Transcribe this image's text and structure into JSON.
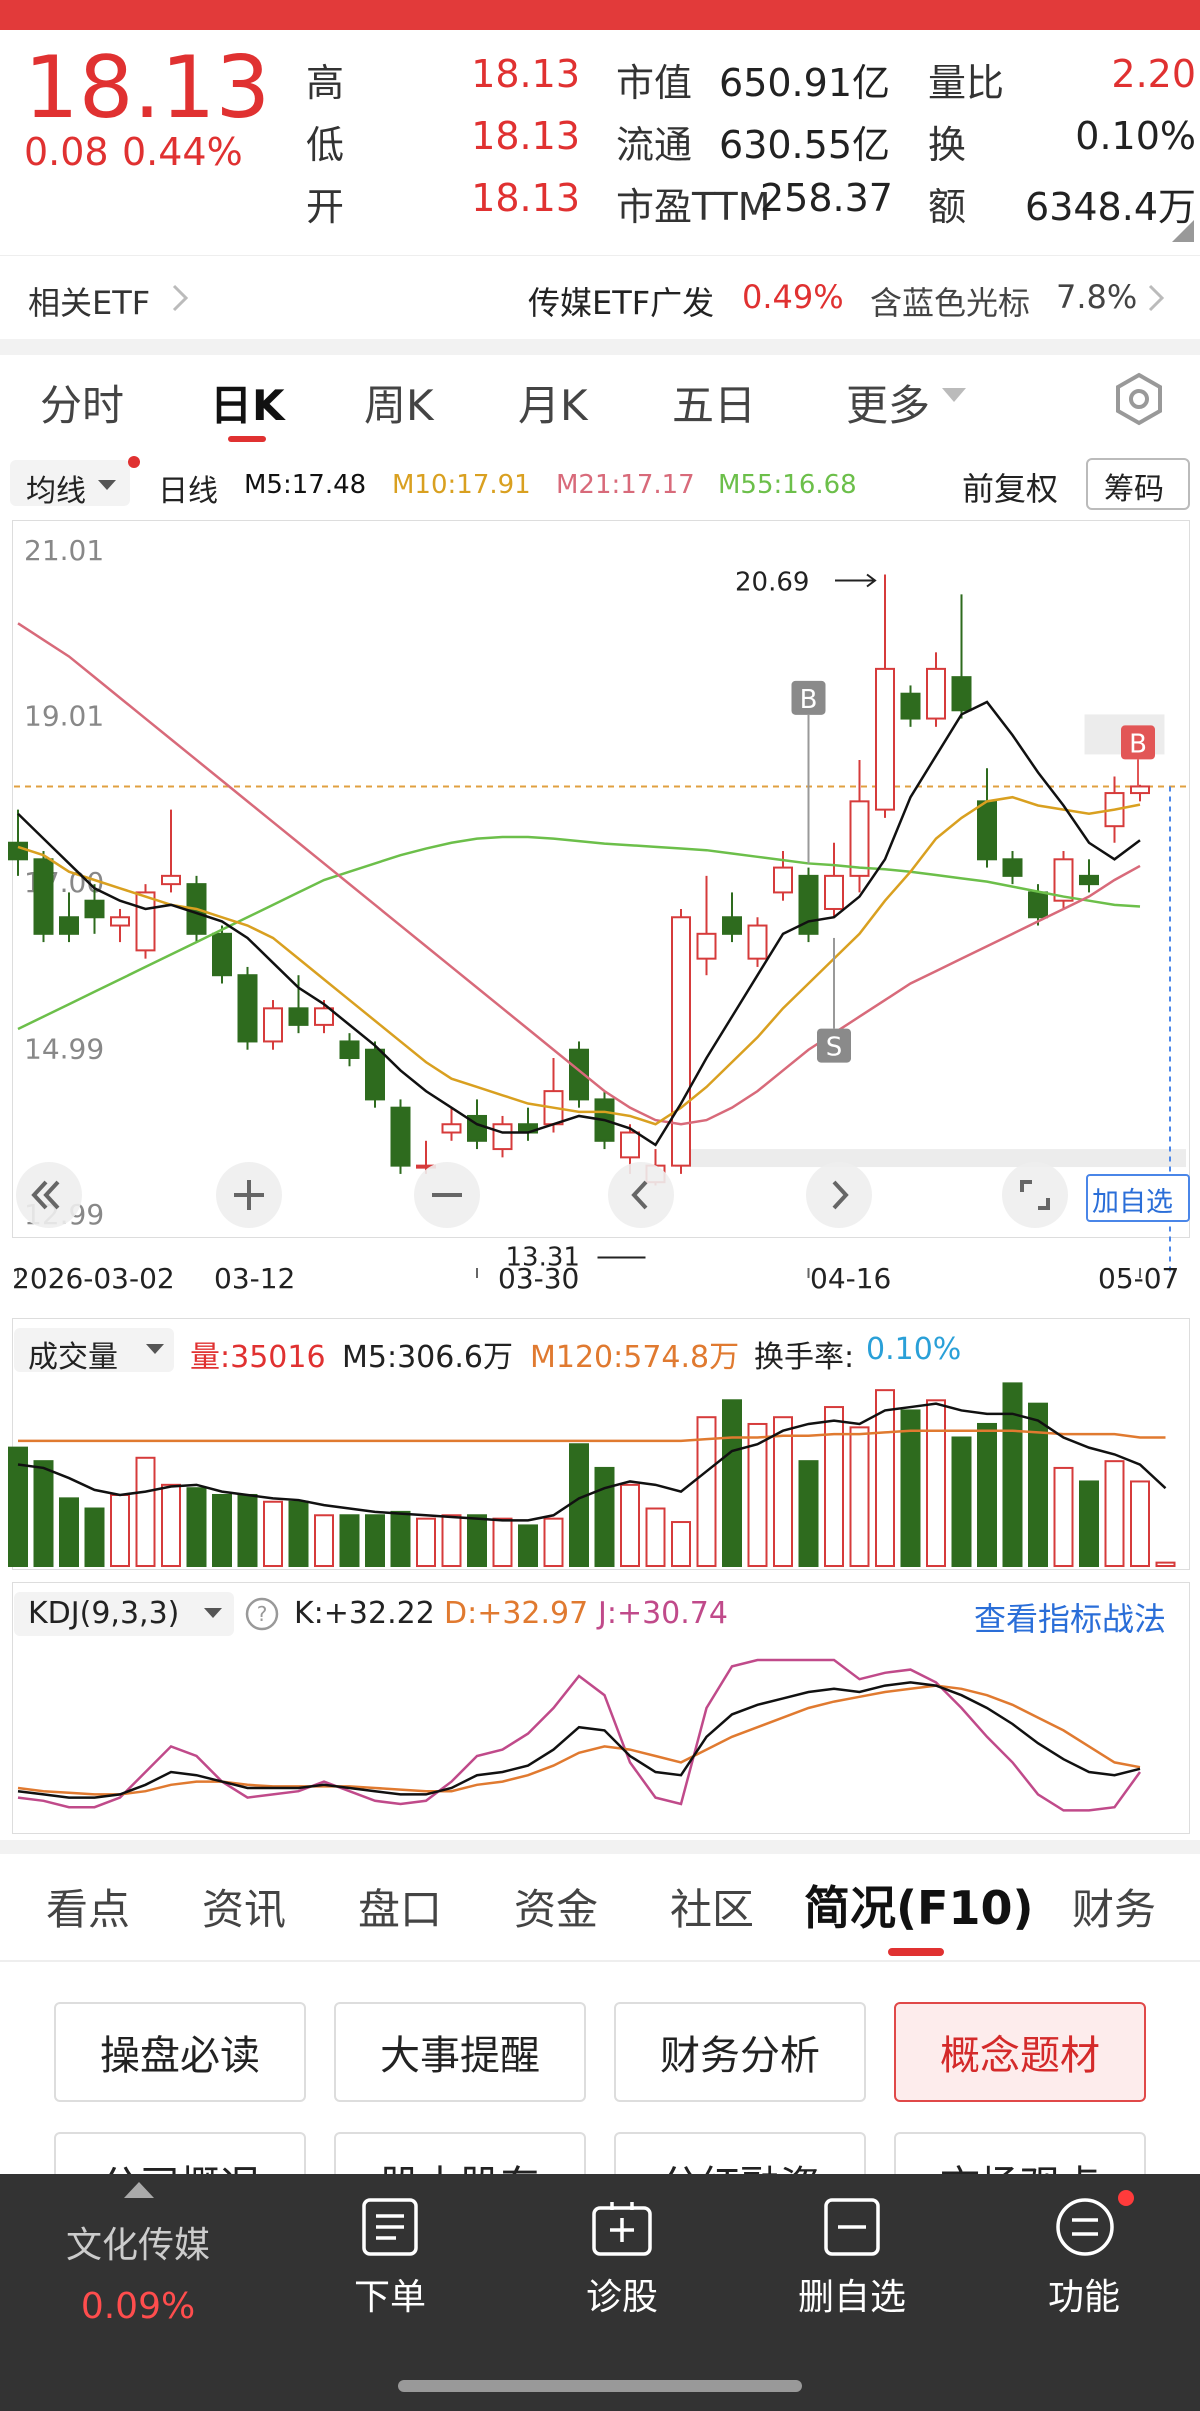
{
  "quote": {
    "price": "18.13",
    "change": "0.08",
    "change_pct": "0.44%",
    "high_label": "高",
    "high": "18.13",
    "low_label": "低",
    "low": "18.13",
    "open_label": "开",
    "open": "18.13",
    "mktcap_label": "市值",
    "mktcap": "650.91亿",
    "float_label": "流通",
    "float": "630.55亿",
    "pe_label": "市盈TTM",
    "pe": "258.37",
    "volratio_label": "量比",
    "volratio": "2.20",
    "turnover_label": "换",
    "turnover": "0.10%",
    "amount_label": "额",
    "amount": "6348.4万"
  },
  "etf": {
    "label": "相关ETF",
    "etf1_name": "传媒ETF广发",
    "etf1_pct": "0.49%",
    "etf2_name": "含蓝色光标",
    "etf2_pct": "7.8%"
  },
  "tabs": [
    "分时",
    "日K",
    "周K",
    "月K",
    "五日",
    "更多"
  ],
  "ma": {
    "selector": "均线",
    "period": "日线",
    "m5": "M5:17.48",
    "m10": "M10:17.91",
    "m21": "M21:17.17",
    "m55": "M55:16.68",
    "adjust": "前复权",
    "chip": "筹码",
    "colors": {
      "m5": "#111111",
      "m10": "#d9a020",
      "m21": "#d86a7a",
      "m55": "#6cbf4a"
    }
  },
  "chart_data": {
    "type": "candlestick",
    "y_ticks": [
      "21.01",
      "19.01",
      "17.00",
      "14.99",
      "12.99"
    ],
    "ylim": [
      12.99,
      21.01
    ],
    "x_ticks": [
      "2026-03-02",
      "03-12",
      "03-30",
      "04-16",
      "05-07"
    ],
    "high_mark": "20.69",
    "low_mark": "13.31",
    "markers": [
      "B",
      "S",
      "B"
    ],
    "add_watch": "加自选",
    "candles": [
      [
        17.45,
        17.25,
        17.85,
        17.05
      ],
      [
        17.25,
        16.35,
        17.35,
        16.25
      ],
      [
        16.55,
        16.35,
        16.85,
        16.25
      ],
      [
        16.75,
        16.55,
        16.95,
        16.35
      ],
      [
        16.45,
        16.55,
        16.65,
        16.25
      ],
      [
        16.15,
        16.85,
        16.95,
        16.05
      ],
      [
        16.95,
        17.05,
        17.85,
        16.85
      ],
      [
        16.95,
        16.35,
        17.05,
        16.25
      ],
      [
        16.35,
        15.85,
        16.45,
        15.75
      ],
      [
        15.85,
        15.05,
        15.95,
        14.95
      ],
      [
        15.05,
        15.45,
        15.55,
        14.95
      ],
      [
        15.45,
        15.25,
        15.85,
        15.15
      ],
      [
        15.25,
        15.45,
        15.55,
        15.15
      ],
      [
        15.05,
        14.85,
        15.15,
        14.75
      ],
      [
        14.95,
        14.35,
        15.05,
        14.25
      ],
      [
        14.25,
        13.55,
        14.35,
        13.45
      ],
      [
        13.55,
        13.55,
        13.85,
        13.45
      ],
      [
        13.95,
        14.05,
        14.25,
        13.85
      ],
      [
        14.15,
        13.85,
        14.35,
        13.75
      ],
      [
        13.75,
        14.05,
        14.15,
        13.65
      ],
      [
        14.05,
        13.95,
        14.25,
        13.85
      ],
      [
        14.05,
        14.45,
        14.85,
        13.95
      ],
      [
        14.95,
        14.35,
        15.05,
        14.25
      ],
      [
        14.35,
        13.85,
        14.45,
        13.75
      ],
      [
        13.65,
        13.95,
        14.05,
        13.45
      ],
      [
        13.35,
        13.55,
        13.75,
        13.31
      ],
      [
        13.55,
        16.55,
        16.65,
        13.45
      ],
      [
        16.05,
        16.35,
        17.05,
        15.85
      ],
      [
        16.55,
        16.35,
        16.85,
        16.25
      ],
      [
        16.05,
        16.45,
        16.55,
        15.95
      ],
      [
        16.85,
        17.15,
        17.35,
        16.75
      ],
      [
        17.05,
        16.35,
        17.15,
        16.25
      ],
      [
        16.65,
        17.05,
        17.45,
        16.55
      ],
      [
        17.05,
        17.95,
        18.45,
        16.85
      ],
      [
        17.85,
        19.55,
        20.69,
        17.75
      ],
      [
        19.25,
        18.95,
        19.35,
        18.85
      ],
      [
        18.95,
        19.55,
        19.75,
        18.85
      ],
      [
        19.45,
        19.05,
        20.45,
        18.95
      ],
      [
        17.95,
        17.25,
        18.35,
        17.15
      ],
      [
        17.25,
        17.05,
        17.35,
        16.95
      ],
      [
        16.85,
        16.55,
        16.95,
        16.45
      ],
      [
        16.75,
        17.25,
        17.35,
        16.65
      ],
      [
        17.05,
        16.95,
        17.25,
        16.85
      ],
      [
        17.65,
        18.05,
        18.25,
        17.45
      ],
      [
        18.05,
        18.13,
        18.15,
        17.95
      ]
    ],
    "m5": [
      17.8,
      17.5,
      17.2,
      16.9,
      16.75,
      16.65,
      16.7,
      16.6,
      16.5,
      16.3,
      16.0,
      15.7,
      15.5,
      15.25,
      15.0,
      14.7,
      14.45,
      14.25,
      14.05,
      13.95,
      13.95,
      14.05,
      14.15,
      14.1,
      14.0,
      13.8,
      14.3,
      14.85,
      15.35,
      15.85,
      16.35,
      16.5,
      16.55,
      16.8,
      17.25,
      18.0,
      18.5,
      19.0,
      19.15,
      18.75,
      18.3,
      17.9,
      17.45,
      17.25,
      17.48
    ],
    "m10": [
      17.4,
      17.3,
      17.1,
      17.0,
      16.9,
      16.8,
      16.7,
      16.65,
      16.55,
      16.45,
      16.3,
      16.05,
      15.8,
      15.55,
      15.3,
      15.05,
      14.8,
      14.6,
      14.5,
      14.4,
      14.3,
      14.25,
      14.2,
      14.2,
      14.15,
      14.05,
      14.25,
      14.5,
      14.8,
      15.1,
      15.45,
      15.75,
      16.05,
      16.35,
      16.75,
      17.1,
      17.5,
      17.75,
      17.95,
      18.0,
      17.9,
      17.85,
      17.8,
      17.85,
      17.91
    ],
    "m21": [
      20.1,
      19.9,
      19.7,
      19.45,
      19.2,
      18.95,
      18.7,
      18.45,
      18.2,
      17.95,
      17.7,
      17.45,
      17.2,
      16.95,
      16.7,
      16.45,
      16.2,
      15.95,
      15.7,
      15.45,
      15.2,
      14.95,
      14.7,
      14.45,
      14.25,
      14.1,
      14.05,
      14.1,
      14.25,
      14.45,
      14.7,
      14.95,
      15.15,
      15.35,
      15.55,
      15.75,
      15.9,
      16.05,
      16.2,
      16.35,
      16.5,
      16.65,
      16.8,
      17.0,
      17.17
    ],
    "m55": [
      15.2,
      15.35,
      15.5,
      15.65,
      15.8,
      15.95,
      16.1,
      16.25,
      16.4,
      16.55,
      16.7,
      16.85,
      17.0,
      17.1,
      17.2,
      17.3,
      17.38,
      17.45,
      17.5,
      17.52,
      17.52,
      17.5,
      17.47,
      17.44,
      17.42,
      17.4,
      17.38,
      17.36,
      17.32,
      17.28,
      17.24,
      17.2,
      17.18,
      17.15,
      17.13,
      17.1,
      17.06,
      17.02,
      16.98,
      16.92,
      16.86,
      16.8,
      16.75,
      16.7,
      16.68
    ]
  },
  "volume": {
    "title": "成交量",
    "vol": "量:35016",
    "m5": "M5:306.6万",
    "m120": "M120:574.8万",
    "turnover_label": "换手率:",
    "turnover": "0.10%",
    "bars": [
      70,
      62,
      40,
      34,
      42,
      64,
      48,
      46,
      42,
      42,
      38,
      38,
      30,
      30,
      30,
      32,
      28,
      30,
      30,
      28,
      24,
      28,
      72,
      58,
      48,
      34,
      26,
      88,
      98,
      84,
      88,
      62,
      94,
      82,
      104,
      92,
      98,
      76,
      84,
      108,
      96,
      58,
      50,
      62,
      50,
      2
    ],
    "m5_line": [
      60,
      58,
      52,
      45,
      42,
      44,
      47,
      48,
      44,
      42,
      40,
      39,
      36,
      34,
      32,
      31,
      30,
      29,
      28,
      27,
      27,
      30,
      40,
      46,
      50,
      48,
      44,
      56,
      68,
      72,
      80,
      84,
      86,
      84,
      92,
      94,
      96,
      92,
      90,
      90,
      86,
      76,
      70,
      66,
      60,
      46
    ],
    "m120_line": [
      74,
      74,
      74,
      74,
      74,
      74,
      74,
      74,
      74,
      74,
      74,
      74,
      74,
      74,
      74,
      74,
      74,
      74,
      74,
      74,
      74,
      74,
      74,
      74,
      74,
      74,
      74,
      75,
      76,
      76,
      77,
      77,
      78,
      78,
      79,
      80,
      80,
      80,
      80,
      80,
      79,
      78,
      78,
      78,
      76,
      76
    ]
  },
  "kdj": {
    "title": "KDJ(9,3,3)",
    "k": "K:+32.22",
    "d": "D:+32.97",
    "j": "J:+30.74",
    "link": "查看指标战法",
    "k_line": [
      18,
      16,
      14,
      14,
      16,
      22,
      30,
      28,
      24,
      20,
      20,
      20,
      22,
      20,
      18,
      16,
      16,
      20,
      28,
      30,
      34,
      44,
      58,
      56,
      40,
      30,
      28,
      52,
      66,
      72,
      76,
      80,
      82,
      80,
      84,
      86,
      84,
      78,
      70,
      60,
      48,
      38,
      30,
      28,
      32
    ],
    "d_line": [
      20,
      18,
      17,
      16,
      16,
      18,
      22,
      24,
      24,
      22,
      21,
      21,
      21,
      21,
      20,
      19,
      18,
      18,
      22,
      24,
      28,
      34,
      42,
      46,
      44,
      40,
      36,
      44,
      52,
      58,
      64,
      70,
      74,
      77,
      80,
      82,
      84,
      82,
      78,
      72,
      64,
      56,
      46,
      36,
      33
    ],
    "j_line": [
      14,
      12,
      8,
      8,
      14,
      30,
      46,
      40,
      24,
      14,
      16,
      18,
      24,
      18,
      12,
      10,
      12,
      24,
      40,
      44,
      54,
      70,
      90,
      78,
      36,
      14,
      10,
      70,
      96,
      100,
      100,
      100,
      100,
      88,
      92,
      94,
      86,
      70,
      52,
      36,
      16,
      6,
      6,
      8,
      30
    ]
  },
  "bottom_tabs": [
    "看点",
    "资讯",
    "盘口",
    "资金",
    "社区",
    "简况(F10)",
    "财务"
  ],
  "f10_buttons": [
    "操盘必读",
    "大事提醒",
    "财务分析",
    "概念题材",
    "公司概况",
    "股本股东",
    "分红融资",
    "市场观点"
  ],
  "footer": {
    "index_name": "文化传媒",
    "index_pct": "0.09%",
    "order": "下单",
    "diagnose": "诊股",
    "remove_watch": "删自选",
    "functions": "功能"
  }
}
